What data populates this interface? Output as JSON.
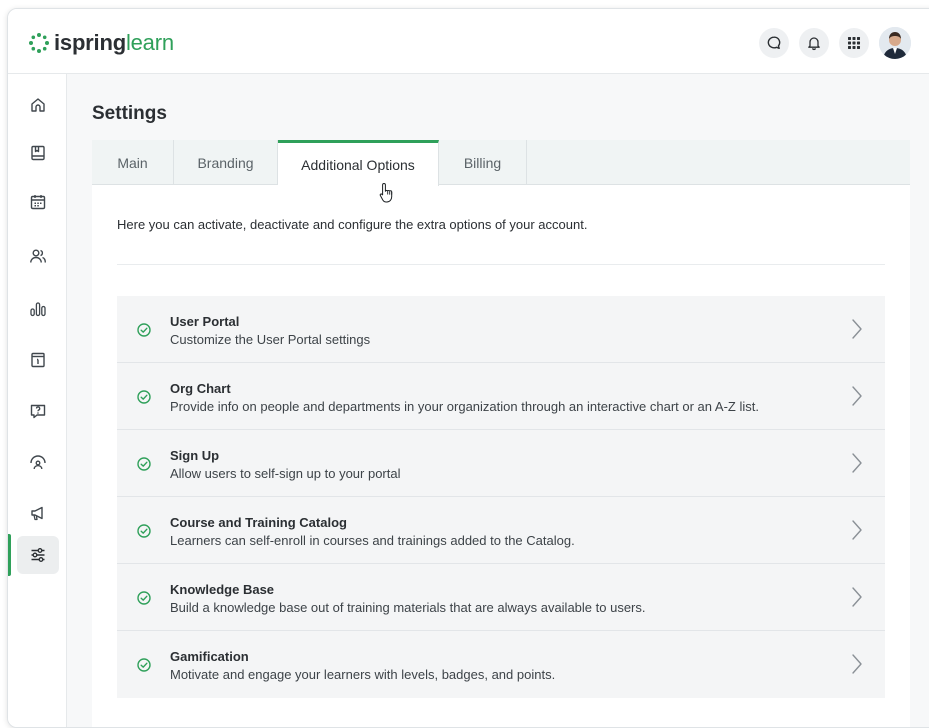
{
  "app": {
    "logo_part1": "ispring",
    "logo_part2": "learn"
  },
  "header": {
    "icons": [
      "chat-icon",
      "bell-icon",
      "apps-grid-icon",
      "user-avatar"
    ]
  },
  "sidebar": {
    "items": [
      {
        "name": "home-icon"
      },
      {
        "name": "courses-book-icon"
      },
      {
        "name": "calendar-icon"
      },
      {
        "name": "users-icon"
      },
      {
        "name": "reports-icon"
      },
      {
        "name": "info-icon"
      },
      {
        "name": "question-icon"
      },
      {
        "name": "gauge-icon"
      },
      {
        "name": "megaphone-icon"
      },
      {
        "name": "settings-sliders-icon",
        "active": true
      }
    ]
  },
  "page": {
    "title": "Settings",
    "intro": "Here you can activate, deactivate and configure the extra options of your account."
  },
  "tabs": [
    {
      "label": "Main"
    },
    {
      "label": "Branding"
    },
    {
      "label": "Additional Options",
      "active": true
    },
    {
      "label": "Billing"
    }
  ],
  "options": [
    {
      "title": "User Portal",
      "desc": "Customize the User Portal settings"
    },
    {
      "title": "Org Chart",
      "desc": "Provide info on people and departments in your organization through an interactive chart or an A-Z list."
    },
    {
      "title": "Sign Up",
      "desc": "Allow users to self-sign up to your portal"
    },
    {
      "title": "Course and Training Catalog",
      "desc": "Learners can self-enroll in courses and trainings added to the Catalog."
    },
    {
      "title": "Knowledge Base",
      "desc": "Build a knowledge base out of training materials that are always available to users."
    },
    {
      "title": "Gamification",
      "desc": "Motivate and engage your learners with levels, badges, and points."
    }
  ],
  "colors": {
    "accent": "#2fa05a",
    "text": "#2b2f33"
  }
}
